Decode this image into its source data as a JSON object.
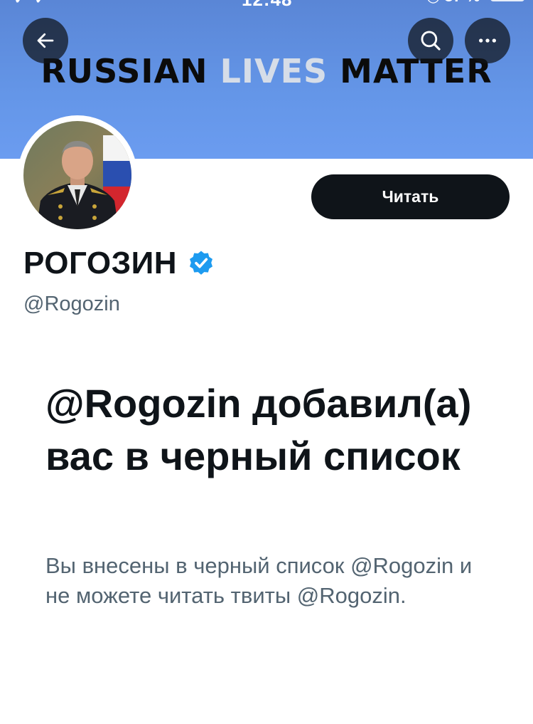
{
  "banner": {
    "slogan_part1": "RUSSIAN",
    "slogan_part2": "LIVES",
    "slogan_part3": "MATTER",
    "color": "#6496e8"
  },
  "header": {
    "back_icon": "arrow-left-icon",
    "search_icon": "search-icon",
    "more_icon": "more-horizontal-icon"
  },
  "profile": {
    "display_name": "РОГОЗИН",
    "handle": "@Rogozin",
    "verified": true,
    "follow_label": "Читать"
  },
  "blocked": {
    "title": "@Rogozin добавил(а) вас в черный список",
    "description": "Вы внесены в черный список @Rogozin и не можете читать твиты @Rogozin."
  },
  "colors": {
    "accent_dark": "#0f1419",
    "secondary_text": "#536471",
    "verified_blue": "#1d9bf0"
  }
}
